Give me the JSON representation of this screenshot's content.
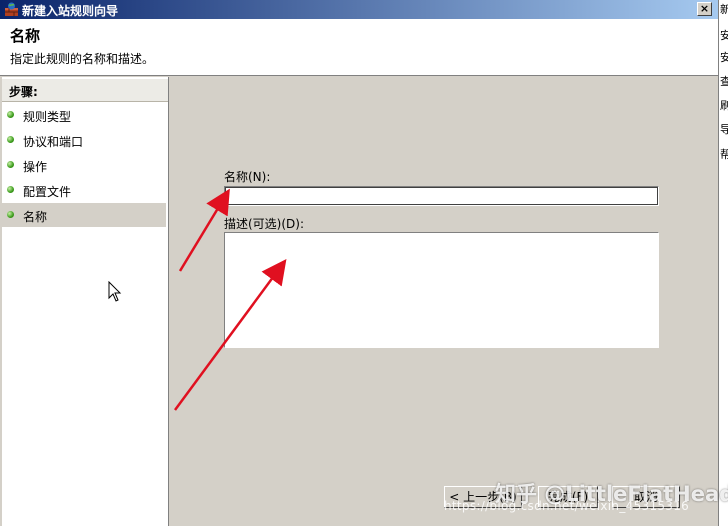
{
  "window": {
    "title": "新建入站规则向导",
    "close_label": "×"
  },
  "header": {
    "title": "名称",
    "subtitle": "指定此规则的名称和描述。"
  },
  "steps": {
    "heading": "步骤:",
    "items": [
      {
        "label": "规则类型"
      },
      {
        "label": "协议和端口"
      },
      {
        "label": "操作"
      },
      {
        "label": "配置文件"
      },
      {
        "label": "名称"
      }
    ],
    "active_index": 4
  },
  "form": {
    "name_label": "名称(N):",
    "name_value": "",
    "description_label": "描述(可选)(D):",
    "description_value": ""
  },
  "buttons": {
    "back": "< 上一步(B)",
    "finish": "完成(F)",
    "cancel": "取消"
  },
  "right_strip": [
    "新",
    "安",
    "安",
    "查",
    "刷",
    "导",
    "帮"
  ],
  "watermark": {
    "brand": "知乎 @LittleFlatHead",
    "url": "https://blog.csdn.net/weixin_45315316"
  },
  "colors": {
    "titlebar_start": "#0a246a",
    "arrow": "#e01020",
    "step_dot": "#3c9c1c"
  }
}
